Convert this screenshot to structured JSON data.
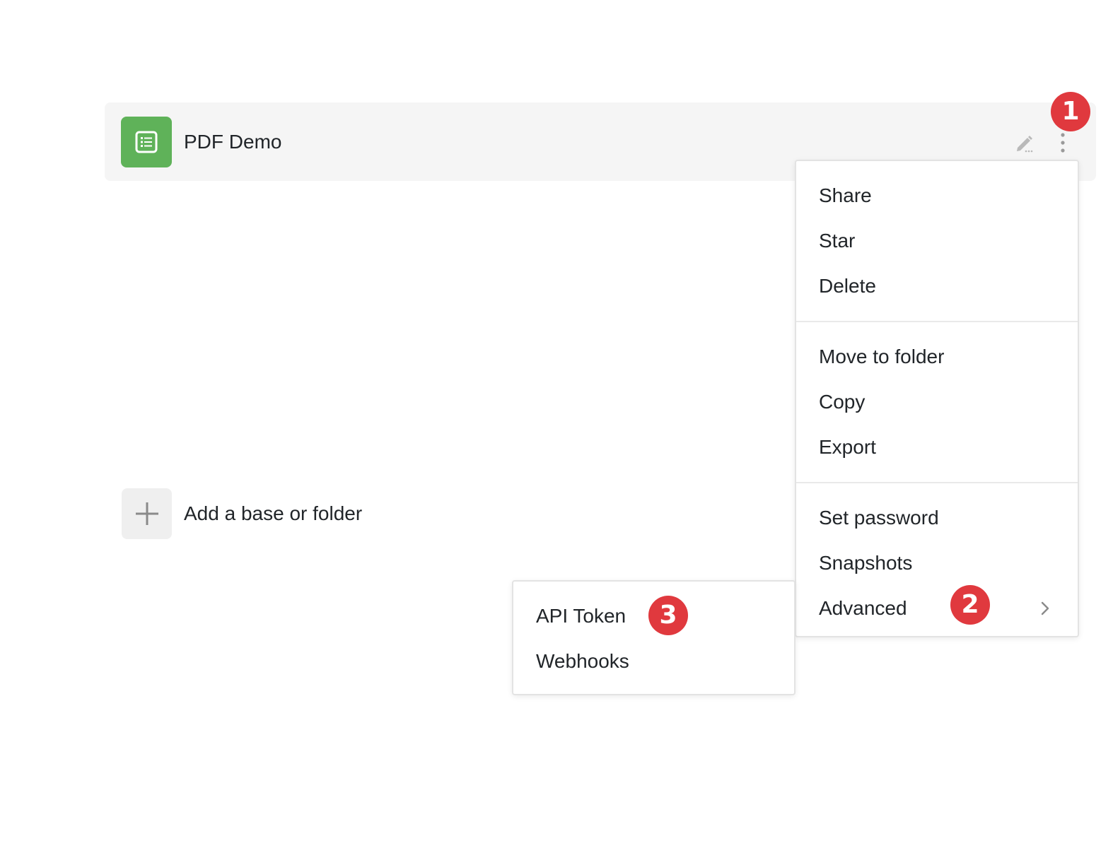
{
  "base": {
    "name": "PDF Demo",
    "icon": "table-list-icon",
    "icon_color": "#5fb259"
  },
  "add_base": {
    "label": "Add a base or folder"
  },
  "menu": {
    "sections": [
      [
        "Share",
        "Star",
        "Delete"
      ],
      [
        "Move to folder",
        "Copy",
        "Export"
      ],
      [
        "Set password",
        "Snapshots",
        "Advanced"
      ]
    ]
  },
  "submenu": {
    "items": [
      "API Token",
      "Webhooks"
    ]
  },
  "badges": {
    "one": "1",
    "two": "2",
    "three": "3",
    "color": "#e0393e"
  }
}
